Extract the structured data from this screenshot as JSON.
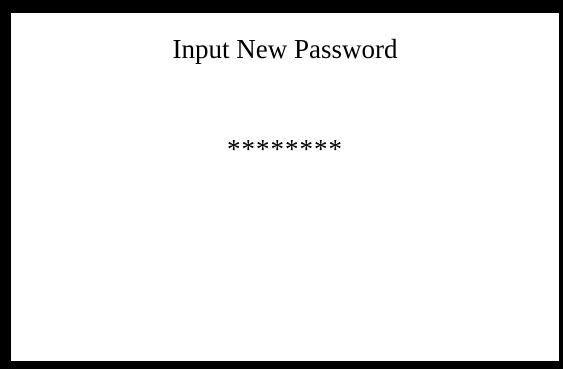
{
  "screen": {
    "title": "Input New Password",
    "password_value": "********"
  },
  "colors": {
    "frame": "#000000",
    "background": "#ffffff",
    "text": "#000000"
  }
}
